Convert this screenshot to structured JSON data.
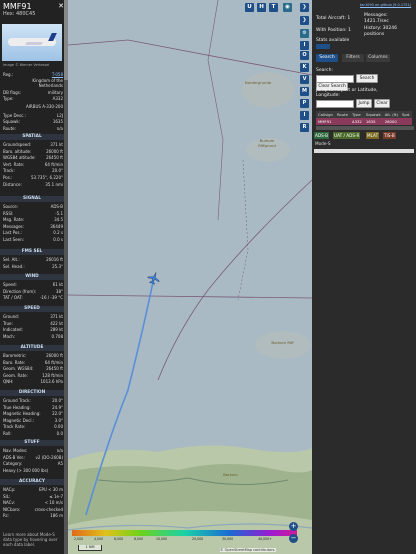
{
  "aircraft": {
    "callsign": "MMF91",
    "hex": "Hex: 480C45",
    "image_credit": "Image © Werner Vertessel",
    "reg_label": "Reg.:",
    "reg_value": "T-058",
    "country": "Kingdom of the Netherlands",
    "db_flags_label": "DB flags:",
    "db_flags_value": "military",
    "type_label": "Type:",
    "type_value": "A332",
    "type_full": "AIRBUS A-330-200",
    "type_desc_label": "Type Desc.:",
    "type_desc_value": "L2J",
    "squawk_label": "Squawk:",
    "squawk_value": "1635",
    "route_label": "Route:",
    "route_value": "n/a"
  },
  "sections": {
    "spatial": "SPATIAL",
    "signal": "SIGNAL",
    "fms": "FMS SEL",
    "wind": "WIND",
    "speed": "SPEED",
    "altitude": "ALTITUDE",
    "direction": "DIRECTION",
    "stuff": "STUFF",
    "accuracy": "ACCURACY"
  },
  "spatial": [
    [
      "Groundspeed:",
      "371 kt"
    ],
    [
      "Baro. altitude:",
      "26000 ft"
    ],
    [
      "WGS84 altitude:",
      "26450 ft"
    ],
    [
      "Vert. Rate:",
      "64 ft/min"
    ],
    [
      "Track:",
      "20.0°"
    ],
    [
      "Pos.:",
      "53.735°, 6.220°"
    ],
    [
      "Distance:",
      "35.1 nmi"
    ]
  ],
  "signal": [
    [
      "Source:",
      "ADS-B"
    ],
    [
      "RSSI:",
      "-5.1"
    ],
    [
      "Msg. Rate:",
      "34.5"
    ],
    [
      "Messages:",
      "36449"
    ],
    [
      "Last Pos.:",
      "0.2 s"
    ],
    [
      "Last Seen:",
      "0.0 s"
    ]
  ],
  "fms": [
    [
      "Sel. Alt.:",
      "26016 ft"
    ],
    [
      "Sel. Head.:",
      "25.3°"
    ]
  ],
  "wind": [
    [
      "Speed:",
      "61 kt"
    ],
    [
      "Direction (from):",
      "38°"
    ],
    [
      "TAT / OAT:",
      "-16 / -39 °C"
    ]
  ],
  "speed": [
    [
      "Ground:",
      "371 kt"
    ],
    [
      "True:",
      "422 kt"
    ],
    [
      "Indicated:",
      "289 kt"
    ],
    [
      "Mach:",
      "0.708"
    ]
  ],
  "altitude": [
    [
      "Barometric:",
      "26000 ft"
    ],
    [
      "Baro. Rate:",
      "64 ft/min"
    ],
    [
      "Geom. WGS84:",
      "26450 ft"
    ],
    [
      "Geom. Rate:",
      "128 ft/min"
    ],
    [
      "QNH:",
      "1013.6 hPa"
    ]
  ],
  "direction": [
    [
      "Ground Track:",
      "20.0°"
    ],
    [
      "True Heading:",
      "24.9°"
    ],
    [
      "Magnetic Heading:",
      "22.0°"
    ],
    [
      "Magnetic Decl.:",
      "3.0°"
    ],
    [
      "Track Rate:",
      "0.00"
    ],
    [
      "Roll:",
      "0.0"
    ]
  ],
  "stuff": [
    [
      "Nav. Modes:",
      "n/a"
    ],
    [
      "ADS-B Ver.:",
      "v2 (DO-260B)"
    ],
    [
      "Category:",
      "A5"
    ]
  ],
  "stuff_note": "Heavy (> 300 000 lbs)",
  "accuracy": [
    [
      "NACp:",
      "EPU < 30 m"
    ],
    [
      "SIL:",
      "≤ 1e-7"
    ],
    [
      "NACv:",
      "< 10 m/s"
    ],
    [
      "NICbaro:",
      "cross-checked"
    ],
    [
      "Rc:",
      "186 m"
    ]
  ],
  "help_text": "Learn more about Mode-S data type by hovering over each data label.",
  "map": {
    "labels": [
      "Burkum Riffgrund",
      "Burkum Riff",
      "Nordergrunde",
      "Borkum"
    ],
    "attribution": "© OpenStreetMap contributors.",
    "scale_label": "1 NM",
    "altitude_ticks": [
      "2,000",
      "4,000",
      "6,000",
      "8,000",
      "10,000",
      "20,000",
      "30,000",
      "40,000+"
    ]
  },
  "top_buttons": [
    "U",
    "H",
    "T"
  ],
  "side_buttons": [
    "I",
    "O",
    "K",
    "V",
    "M",
    "P",
    "I",
    "R"
  ],
  "stats": {
    "version_link": "tar1090 on github (9.0.1751)",
    "total_label": "Total Aircraft: 1",
    "with_pos_label": "With Position: 1",
    "messages_label": "Messages:",
    "messages_value": "1421.7/sec",
    "history_label": "History: 30246",
    "history_sub": "positions",
    "stats_label": "Stats available"
  },
  "tabs": [
    "Search",
    "Filters",
    "Columns"
  ],
  "search": {
    "label": "Search:",
    "button": "Search",
    "clear_button": "Clear Search",
    "jump_label": "Jump to Airport or Latitude, Longitude:",
    "jump_button": "Jump",
    "clear2": "Clear"
  },
  "table": {
    "headers": [
      "Callsign",
      "Route",
      "Type",
      "Squawk",
      "Alt. (ft)",
      "Spd."
    ],
    "row": [
      "MMF91",
      "",
      "A332",
      "1635",
      "26000",
      ""
    ]
  },
  "legend_badges": [
    "ADS-B",
    "UAT / ADS-R",
    "MLAT",
    "TIS-B"
  ],
  "mode_s": "Mode-S",
  "colors": {
    "badge_adsb": "#2f6a3f",
    "badge_uat": "#4c6a2a",
    "badge_mlat": "#7a6a20",
    "badge_tisb": "#7a3a2a"
  }
}
